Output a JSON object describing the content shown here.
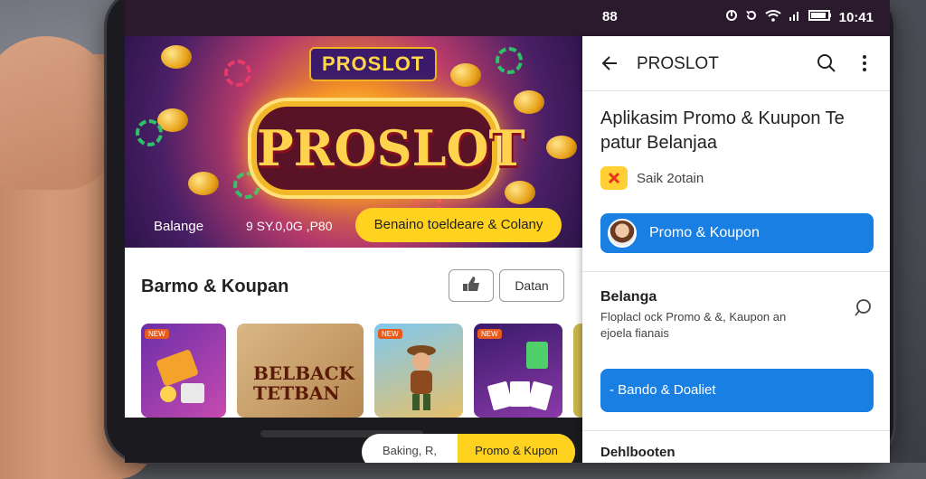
{
  "status_bar": {
    "left_text": "88",
    "time": "10:41"
  },
  "banner": {
    "logo_small": "PROSLOT",
    "logo_big": "PROSLOT",
    "label_left": "Balange",
    "label_mid": "9 SY.0,0G ,P80",
    "cta": "Benaino toeldeare & Colany"
  },
  "left": {
    "section_title": "Barmo & Koupan",
    "filter_button_icon": "thumb-icon",
    "text_button": "Datan",
    "cards": [
      {
        "badge": "NEW",
        "text": ""
      },
      {
        "badge": "",
        "text": "BELBACK\nTETBAN"
      },
      {
        "badge": "NEW",
        "text": ""
      },
      {
        "badge": "NEW",
        "text": ""
      }
    ],
    "bottom_pill": {
      "left": "Baking, R,",
      "right": "Promo & Kupon"
    }
  },
  "right": {
    "topbar_title": "PROSLOT",
    "back_icon": "arrow-left-icon",
    "search_icon": "search-icon",
    "more_icon": "more-vertical-icon",
    "heading_line1": "Aplikasim Promo & Kuupon Te",
    "heading_line2": "patur Belanjaa",
    "app_label": "Saik 2otain",
    "primary_button": "Promo & Koupon",
    "section2_title": "Belanga",
    "section2_desc_line1": "Floplacl ock Promo & &, Kaupon an",
    "section2_desc_line2": "ejoela fianais",
    "secondary_button": "- Bando & Doaliet",
    "section3_title": "Dehlbooten"
  },
  "colors": {
    "accent_blue": "#1a7fe3",
    "accent_yellow": "#ffd21f"
  }
}
